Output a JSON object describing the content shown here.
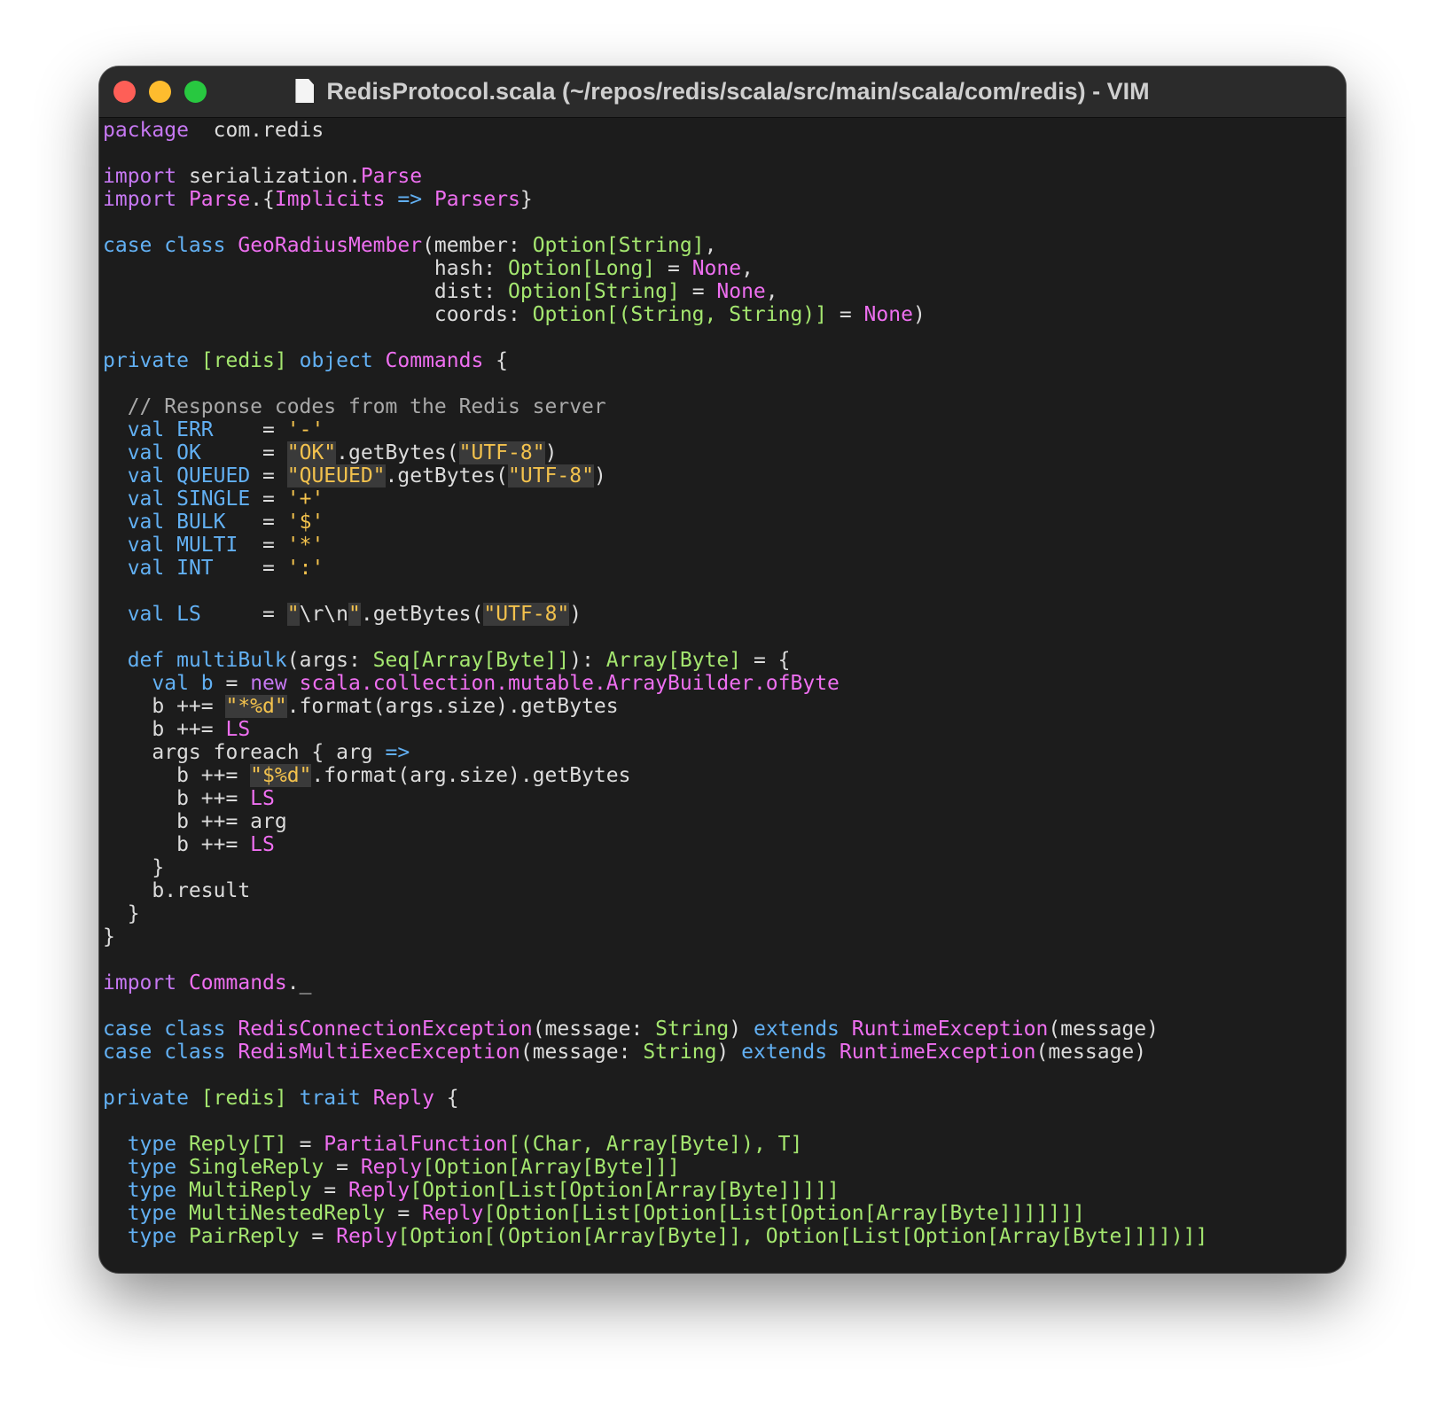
{
  "window": {
    "title": "RedisProtocol.scala (~/repos/redis/scala/src/main/scala/com/redis) - VIM",
    "controls": {
      "close": "close-button",
      "minimize": "minimize-button",
      "zoom": "zoom-button"
    }
  },
  "colors": {
    "keyword_purple": "#c678f2",
    "keyword_blue": "#62b0f3",
    "type_green": "#a4e66f",
    "name_magenta": "#ee6ff0",
    "string_yellow": "#f3c24d",
    "comment_gray": "#a9a9a9",
    "text": "#dcdcdc",
    "background": "#1c1c1c"
  },
  "code_lines": [
    [
      [
        "kw",
        "package"
      ],
      [
        "",
        "  com.redis"
      ]
    ],
    [],
    [
      [
        "kw",
        "import"
      ],
      [
        "",
        " serialization."
      ],
      [
        "fn",
        "Parse"
      ]
    ],
    [
      [
        "kw",
        "import"
      ],
      [
        "",
        " "
      ],
      [
        "fn",
        "Parse"
      ],
      [
        "",
        ".{"
      ],
      [
        "fn",
        "Implicits"
      ],
      [
        "",
        " "
      ],
      [
        "kb",
        "=>"
      ],
      [
        "",
        " "
      ],
      [
        "fn",
        "Parsers"
      ],
      [
        "",
        "}"
      ]
    ],
    [],
    [
      [
        "kb",
        "case class"
      ],
      [
        "",
        " "
      ],
      [
        "fn",
        "GeoRadiusMember"
      ],
      [
        "",
        "(member: "
      ],
      [
        "ty",
        "Option[String]"
      ],
      [
        "",
        ","
      ]
    ],
    [
      [
        "",
        "                           hash: "
      ],
      [
        "ty",
        "Option[Long]"
      ],
      [
        "",
        " = "
      ],
      [
        "fn",
        "None"
      ],
      [
        "",
        ","
      ]
    ],
    [
      [
        "",
        "                           dist: "
      ],
      [
        "ty",
        "Option[String]"
      ],
      [
        "",
        " = "
      ],
      [
        "fn",
        "None"
      ],
      [
        "",
        ","
      ]
    ],
    [
      [
        "",
        "                           coords: "
      ],
      [
        "ty",
        "Option[(String, String)]"
      ],
      [
        "",
        " = "
      ],
      [
        "fn",
        "None"
      ],
      [
        "",
        ")"
      ]
    ],
    [],
    [
      [
        "kb",
        "private"
      ],
      [
        "",
        " "
      ],
      [
        "ty",
        "[redis]"
      ],
      [
        "",
        " "
      ],
      [
        "kb",
        "object"
      ],
      [
        "",
        " "
      ],
      [
        "fn",
        "Commands"
      ],
      [
        "",
        " {"
      ]
    ],
    [],
    [
      [
        "cm",
        "  // Response codes from the Redis server"
      ]
    ],
    [
      [
        "",
        "  "
      ],
      [
        "kb",
        "val"
      ],
      [
        "",
        " "
      ],
      [
        "kb",
        "ERR"
      ],
      [
        "",
        "    = "
      ],
      [
        "st",
        "'-'"
      ]
    ],
    [
      [
        "",
        "  "
      ],
      [
        "kb",
        "val"
      ],
      [
        "",
        " "
      ],
      [
        "kb",
        "OK"
      ],
      [
        "",
        "     = "
      ],
      [
        "st sq",
        "\"OK\""
      ],
      [
        "",
        ".getBytes("
      ],
      [
        "st sq",
        "\"UTF-8\""
      ],
      [
        "",
        ")"
      ]
    ],
    [
      [
        "",
        "  "
      ],
      [
        "kb",
        "val"
      ],
      [
        "",
        " "
      ],
      [
        "kb",
        "QUEUED"
      ],
      [
        "",
        " = "
      ],
      [
        "st sq",
        "\"QUEUED\""
      ],
      [
        "",
        ".getBytes("
      ],
      [
        "st sq",
        "\"UTF-8\""
      ],
      [
        "",
        ")"
      ]
    ],
    [
      [
        "",
        "  "
      ],
      [
        "kb",
        "val"
      ],
      [
        "",
        " "
      ],
      [
        "kb",
        "SINGLE"
      ],
      [
        "",
        " = "
      ],
      [
        "st",
        "'+'"
      ]
    ],
    [
      [
        "",
        "  "
      ],
      [
        "kb",
        "val"
      ],
      [
        "",
        " "
      ],
      [
        "kb",
        "BULK"
      ],
      [
        "",
        "   = "
      ],
      [
        "st",
        "'$'"
      ]
    ],
    [
      [
        "",
        "  "
      ],
      [
        "kb",
        "val"
      ],
      [
        "",
        " "
      ],
      [
        "kb",
        "MULTI"
      ],
      [
        "",
        "  = "
      ],
      [
        "st",
        "'*'"
      ]
    ],
    [
      [
        "",
        "  "
      ],
      [
        "kb",
        "val"
      ],
      [
        "",
        " "
      ],
      [
        "kb",
        "INT"
      ],
      [
        "",
        "    = "
      ],
      [
        "st",
        "':'"
      ]
    ],
    [],
    [
      [
        "",
        "  "
      ],
      [
        "kb",
        "val"
      ],
      [
        "",
        " "
      ],
      [
        "kb",
        "LS"
      ],
      [
        "",
        "     = "
      ],
      [
        "st sq",
        "\""
      ],
      [
        "",
        "\\r\\n"
      ],
      [
        "st sq",
        "\""
      ],
      [
        "",
        ".getBytes("
      ],
      [
        "st sq",
        "\"UTF-8\""
      ],
      [
        "",
        ")"
      ]
    ],
    [],
    [
      [
        "",
        "  "
      ],
      [
        "kb",
        "def"
      ],
      [
        "",
        " "
      ],
      [
        "kb",
        "multiBulk"
      ],
      [
        "",
        "(args: "
      ],
      [
        "ty",
        "Seq[Array[Byte]]"
      ],
      [
        "",
        "): "
      ],
      [
        "ty",
        "Array[Byte]"
      ],
      [
        "",
        " = {"
      ]
    ],
    [
      [
        "",
        "    "
      ],
      [
        "kb",
        "val"
      ],
      [
        "",
        " "
      ],
      [
        "kb",
        "b"
      ],
      [
        "",
        " = "
      ],
      [
        "kw",
        "new"
      ],
      [
        "",
        " "
      ],
      [
        "fn",
        "scala.collection.mutable.ArrayBuilder.ofByte"
      ]
    ],
    [
      [
        "",
        "    b ++= "
      ],
      [
        "st sq",
        "\"*%d\""
      ],
      [
        "",
        ".format(args.size).getBytes"
      ]
    ],
    [
      [
        "",
        "    b ++= "
      ],
      [
        "fn",
        "LS"
      ]
    ],
    [
      [
        "",
        "    args foreach { arg "
      ],
      [
        "kb",
        "=>"
      ]
    ],
    [
      [
        "",
        "      b ++= "
      ],
      [
        "st sq",
        "\"$%d\""
      ],
      [
        "",
        ".format(arg.size).getBytes"
      ]
    ],
    [
      [
        "",
        "      b ++= "
      ],
      [
        "fn",
        "LS"
      ]
    ],
    [
      [
        "",
        "      b ++= arg"
      ]
    ],
    [
      [
        "",
        "      b ++= "
      ],
      [
        "fn",
        "LS"
      ]
    ],
    [
      [
        "",
        "    }"
      ]
    ],
    [
      [
        "",
        "    b.result"
      ]
    ],
    [
      [
        "",
        "  }"
      ]
    ],
    [
      [
        "",
        "}"
      ]
    ],
    [],
    [
      [
        "kw",
        "import"
      ],
      [
        "",
        " "
      ],
      [
        "fn",
        "Commands"
      ],
      [
        "",
        "._"
      ]
    ],
    [],
    [
      [
        "kb",
        "case class"
      ],
      [
        "",
        " "
      ],
      [
        "fn",
        "RedisConnectionException"
      ],
      [
        "",
        "(message: "
      ],
      [
        "ty",
        "String"
      ],
      [
        "",
        ") "
      ],
      [
        "kb",
        "extends"
      ],
      [
        "",
        " "
      ],
      [
        "fn",
        "RuntimeException"
      ],
      [
        "",
        "(message)"
      ]
    ],
    [
      [
        "kb",
        "case class"
      ],
      [
        "",
        " "
      ],
      [
        "fn",
        "RedisMultiExecException"
      ],
      [
        "",
        "(message: "
      ],
      [
        "ty",
        "String"
      ],
      [
        "",
        ") "
      ],
      [
        "kb",
        "extends"
      ],
      [
        "",
        " "
      ],
      [
        "fn",
        "RuntimeException"
      ],
      [
        "",
        "(message)"
      ]
    ],
    [],
    [
      [
        "kb",
        "private"
      ],
      [
        "",
        " "
      ],
      [
        "ty",
        "[redis]"
      ],
      [
        "",
        " "
      ],
      [
        "kb",
        "trait"
      ],
      [
        "",
        " "
      ],
      [
        "fn",
        "Reply"
      ],
      [
        "",
        " {"
      ]
    ],
    [],
    [
      [
        "",
        "  "
      ],
      [
        "kb",
        "type"
      ],
      [
        "",
        " "
      ],
      [
        "ty",
        "Reply[T]"
      ],
      [
        "",
        " = "
      ],
      [
        "fn",
        "PartialFunction"
      ],
      [
        "ty",
        "[(Char, Array[Byte]), T]"
      ]
    ],
    [
      [
        "",
        "  "
      ],
      [
        "kb",
        "type"
      ],
      [
        "",
        " "
      ],
      [
        "ty",
        "SingleReply"
      ],
      [
        "",
        " = "
      ],
      [
        "fn",
        "Reply"
      ],
      [
        "ty",
        "[Option[Array[Byte]]]"
      ]
    ],
    [
      [
        "",
        "  "
      ],
      [
        "kb",
        "type"
      ],
      [
        "",
        " "
      ],
      [
        "ty",
        "MultiReply"
      ],
      [
        "",
        " = "
      ],
      [
        "fn",
        "Reply"
      ],
      [
        "ty",
        "[Option[List[Option[Array[Byte]]]]]"
      ]
    ],
    [
      [
        "",
        "  "
      ],
      [
        "kb",
        "type"
      ],
      [
        "",
        " "
      ],
      [
        "ty",
        "MultiNestedReply"
      ],
      [
        "",
        " = "
      ],
      [
        "fn",
        "Reply"
      ],
      [
        "ty",
        "[Option[List[Option[List[Option[Array[Byte]]]]]]]"
      ]
    ],
    [
      [
        "",
        "  "
      ],
      [
        "kb",
        "type"
      ],
      [
        "",
        " "
      ],
      [
        "ty",
        "PairReply"
      ],
      [
        "",
        " = "
      ],
      [
        "fn",
        "Reply"
      ],
      [
        "ty",
        "[Option[(Option[Array[Byte]], Option[List[Option[Array[Byte]]]])]]"
      ]
    ]
  ]
}
